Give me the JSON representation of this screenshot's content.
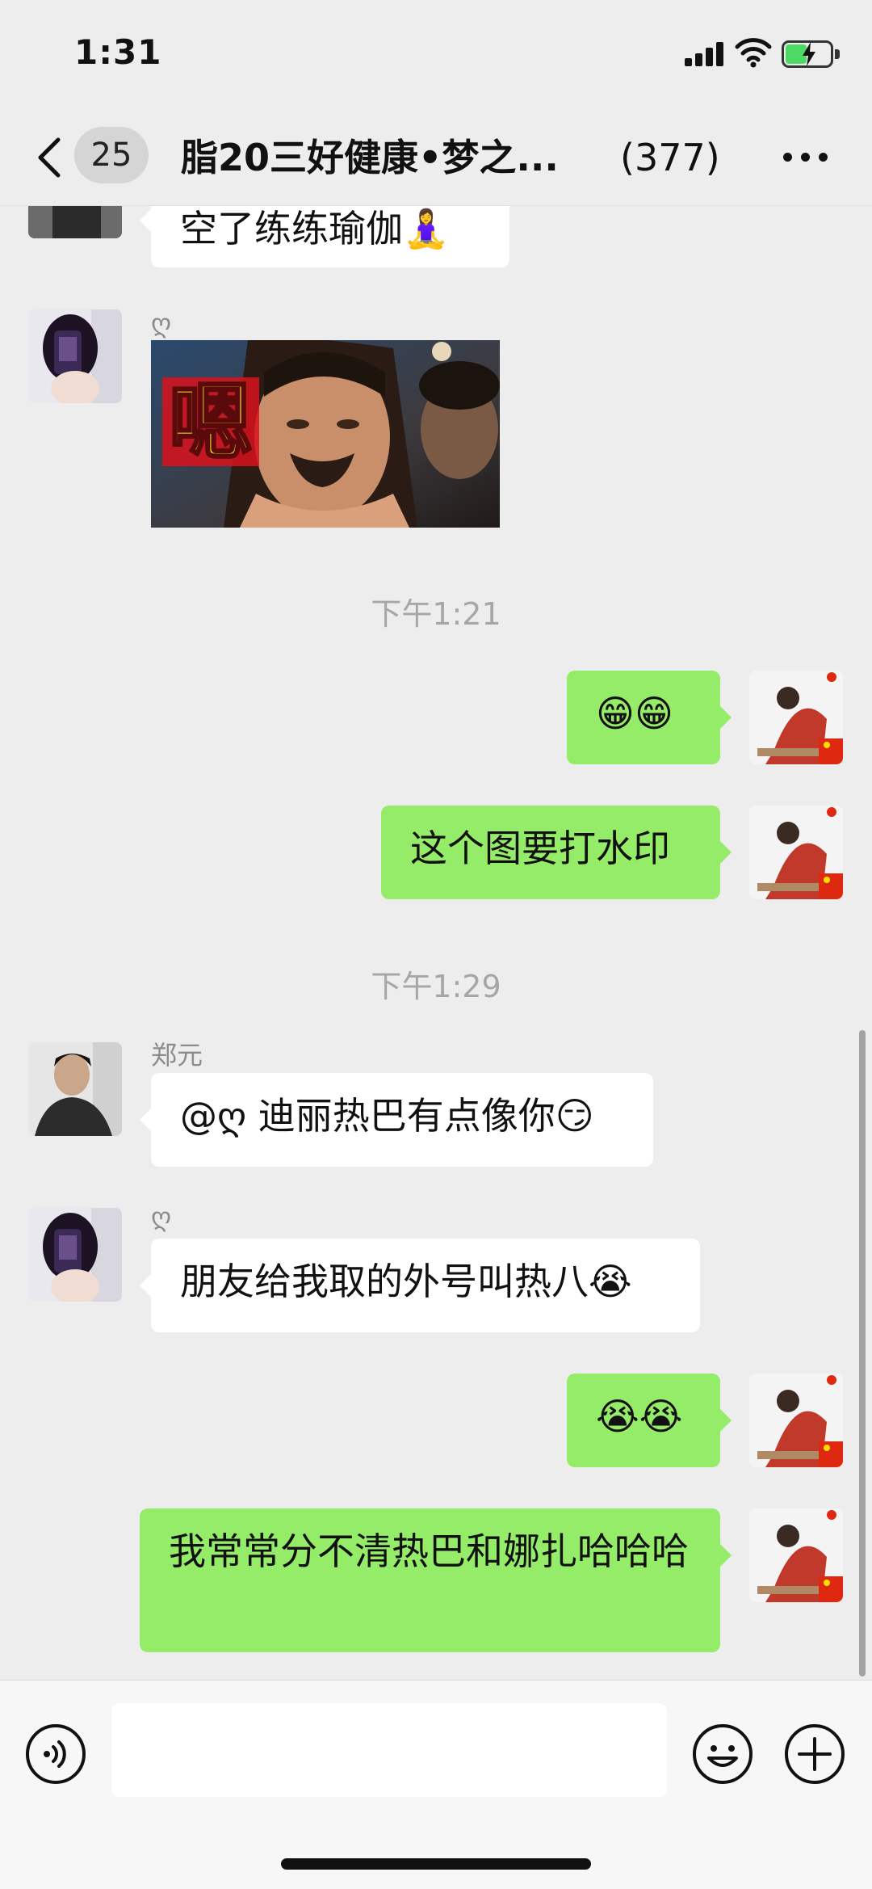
{
  "status": {
    "time": "1:31"
  },
  "header": {
    "unread_count": "25",
    "title": "脂20三好健康•梦之...",
    "member_count": "(377)"
  },
  "messages": {
    "m0_text": "空了练练瑜伽🧘‍♀️",
    "m1_sender": "ღ",
    "m1_image_text": "嗯",
    "ts1": "下午1:21",
    "m2_text": "😁😁",
    "m3_text": "这个图要打水印",
    "ts2": "下午1:29",
    "m4_sender": "郑元",
    "m4_text": "@ღ 迪丽热巴有点像你😏",
    "m5_sender": "ღ",
    "m5_text": "朋友给我取的外号叫热八😭",
    "m6_text": "😭😭",
    "m7_text": "我常常分不清热巴和娜扎哈哈哈"
  },
  "colors": {
    "outgoing_bubble": "#95ec69",
    "incoming_bubble": "#ffffff",
    "background": "#ededed"
  }
}
